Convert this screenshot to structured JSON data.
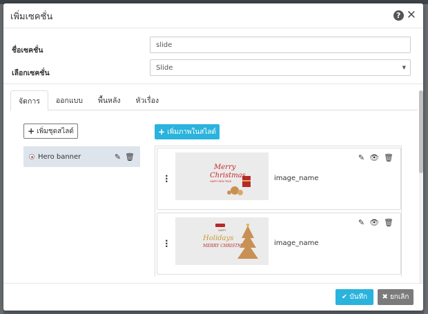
{
  "modal": {
    "title": "เพิ่มเซคชั่น"
  },
  "form": {
    "section_name_label": "ชื่อเซคชั่น",
    "section_name_value": "slide",
    "section_type_label": "เลือกเซคชั่น",
    "section_type_value": "Slide"
  },
  "tabs": [
    {
      "label": "จัดการ",
      "active": true
    },
    {
      "label": "ออกแบบ",
      "active": false
    },
    {
      "label": "พื้นหลัง",
      "active": false
    },
    {
      "label": "หัวเรื่อง",
      "active": false
    }
  ],
  "slide_sets": {
    "add_label": "เพิ่มชุดสไลด์",
    "items": [
      {
        "label": "Hero banner",
        "selected": true
      }
    ]
  },
  "slides": {
    "add_label": "เพิ่มภาพในสไลด์",
    "items": [
      {
        "image_name": "image_name",
        "thumb_text_1": "Merry",
        "thumb_text_2": "Christmas",
        "thumb_subtext": "HAPPY NEW YEAR"
      },
      {
        "image_name": "image_name",
        "thumb_text_1": "Holidays",
        "thumb_text_2": "MERRY CHRISTMAS",
        "thumb_subtext": "HAPPY"
      }
    ]
  },
  "footer": {
    "save_label": "บันทึก",
    "cancel_label": "ยกเลิก"
  },
  "colors": {
    "accent": "#2ab3dc",
    "cancel": "#7b7b7b",
    "selected_row": "#dde4ec",
    "radio_dot": "#d9534f"
  },
  "icons": {
    "help": "question-circle-icon",
    "close": "close-icon",
    "edit": "edit-icon",
    "delete": "trash-icon",
    "view": "eye-icon",
    "drag": "drag-handle-icon",
    "check": "check-icon"
  }
}
